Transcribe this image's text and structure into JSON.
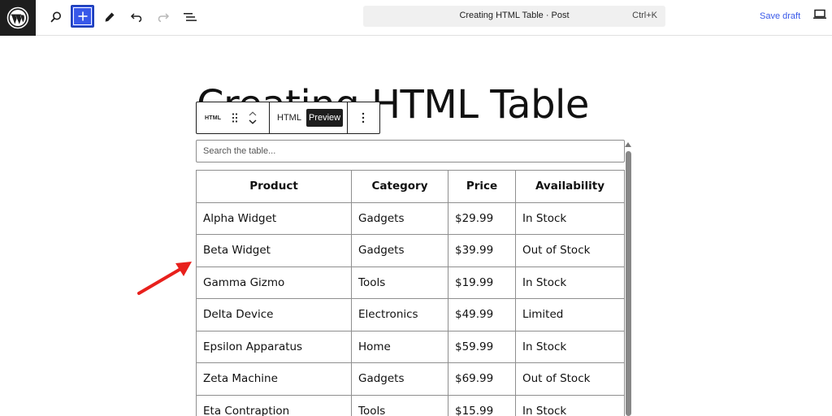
{
  "toolbar": {
    "document_title": "Creating HTML Table · Post",
    "shortcut": "Ctrl+K",
    "save_draft_label": "Save draft",
    "icons": [
      "wordpress-logo",
      "search-icon",
      "plus-icon",
      "pencil-icon",
      "undo-icon",
      "redo-icon",
      "list-view-icon",
      "desktop-icon"
    ],
    "accent_color": "#3858e9"
  },
  "post": {
    "title": "Creating HTML Table"
  },
  "block_toolbar": {
    "block_icon_label": "HTML",
    "mode_html_label": "HTML",
    "mode_preview_label": "Preview",
    "active_mode": "Preview"
  },
  "search": {
    "placeholder": "Search the table..."
  },
  "table": {
    "headers": [
      "Product",
      "Category",
      "Price",
      "Availability"
    ],
    "rows": [
      [
        "Alpha Widget",
        "Gadgets",
        "$29.99",
        "In Stock"
      ],
      [
        "Beta Widget",
        "Gadgets",
        "$39.99",
        "Out of Stock"
      ],
      [
        "Gamma Gizmo",
        "Tools",
        "$19.99",
        "In Stock"
      ],
      [
        "Delta Device",
        "Electronics",
        "$49.99",
        "Limited"
      ],
      [
        "Epsilon Apparatus",
        "Home",
        "$59.99",
        "In Stock"
      ],
      [
        "Zeta Machine",
        "Gadgets",
        "$69.99",
        "Out of Stock"
      ],
      [
        "Eta Contraption",
        "Tools",
        "$15.99",
        "In Stock"
      ]
    ]
  },
  "annotation": {
    "arrow_color": "#e8201c"
  }
}
